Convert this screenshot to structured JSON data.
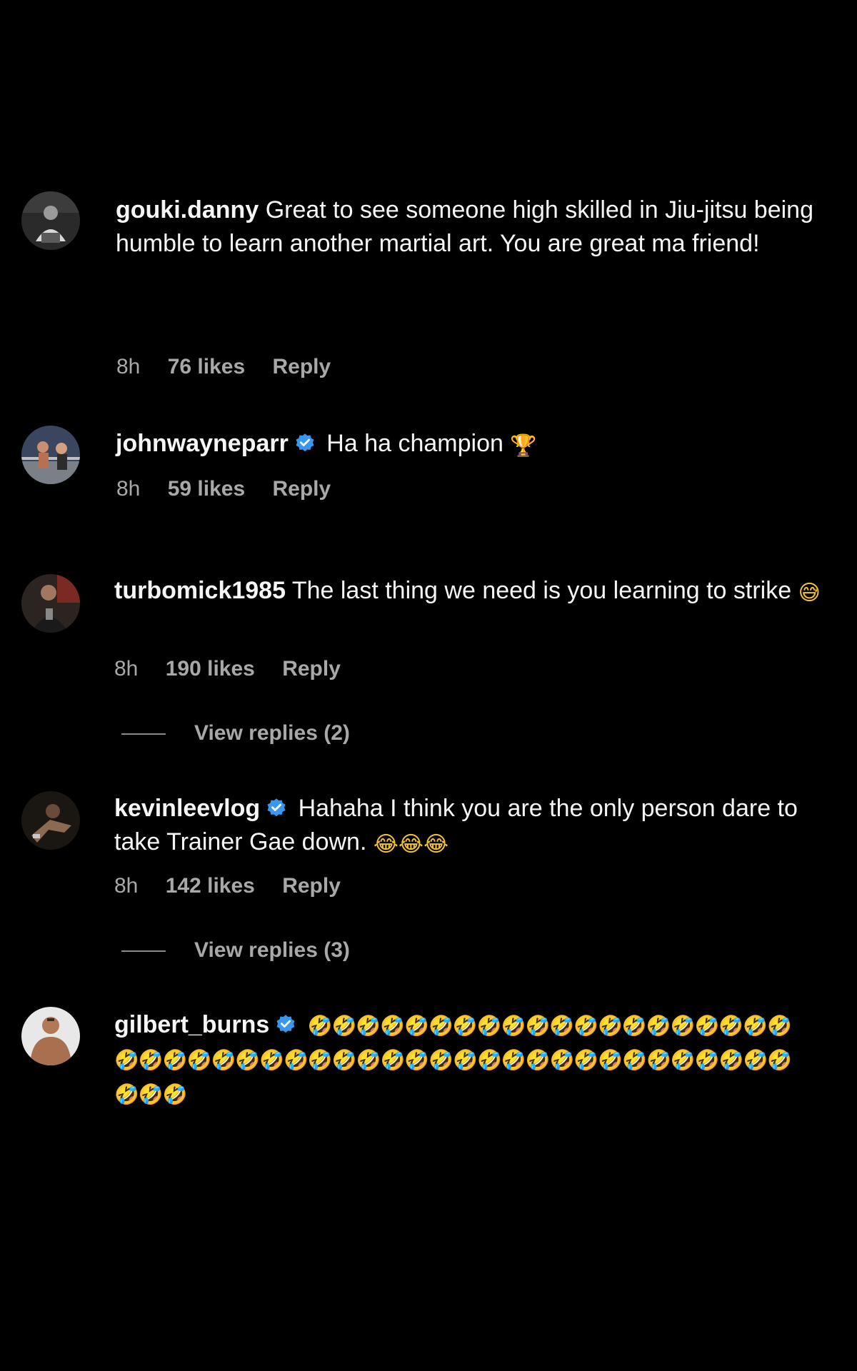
{
  "comments": [
    {
      "username": "gouki.danny",
      "verified": false,
      "text": "Great to see someone high skilled in Jiu-jitsu being humble to learn another martial art. You are great ma friend!",
      "emoji": "",
      "time": "8h",
      "likes": "76 likes",
      "reply": "Reply",
      "avatar_icon": "avatar-photo-person-sitting"
    },
    {
      "username": "johnwayneparr",
      "verified": true,
      "text": "Ha ha champion",
      "emoji": "🏆",
      "time": "8h",
      "likes": "59 likes",
      "reply": "Reply",
      "avatar_icon": "avatar-photo-boxing-ring"
    },
    {
      "username": "turbomick1985",
      "verified": false,
      "text": "The last thing we need is you learning to strike",
      "emoji": "😅",
      "time": "8h",
      "likes": "190 likes",
      "reply": "Reply",
      "view_replies": "View replies (2)",
      "avatar_icon": "avatar-photo-man-gym"
    },
    {
      "username": "kevinleevlog",
      "verified": true,
      "text": "Hahaha I think you are the only person dare to take Trainer Gae down.",
      "emoji": "😂😂😂",
      "time": "8h",
      "likes": "142 likes",
      "reply": "Reply",
      "view_replies": "View replies (3)",
      "avatar_icon": "avatar-photo-fighter"
    },
    {
      "username": "gilbert_burns",
      "verified": true,
      "text": "",
      "emoji": "🤣🤣🤣🤣🤣🤣🤣🤣🤣🤣🤣🤣🤣🤣🤣🤣🤣🤣🤣🤣🤣🤣🤣🤣🤣🤣🤣🤣🤣🤣🤣🤣🤣🤣🤣🤣🤣🤣🤣🤣🤣🤣🤣🤣🤣🤣🤣🤣🤣🤣🤣",
      "avatar_icon": "avatar-photo-shirtless-man"
    }
  ],
  "colors": {
    "background": "#000000",
    "text": "#f5f5f5",
    "meta": "#a8a8a8",
    "verified_badge": "#3897f0"
  }
}
